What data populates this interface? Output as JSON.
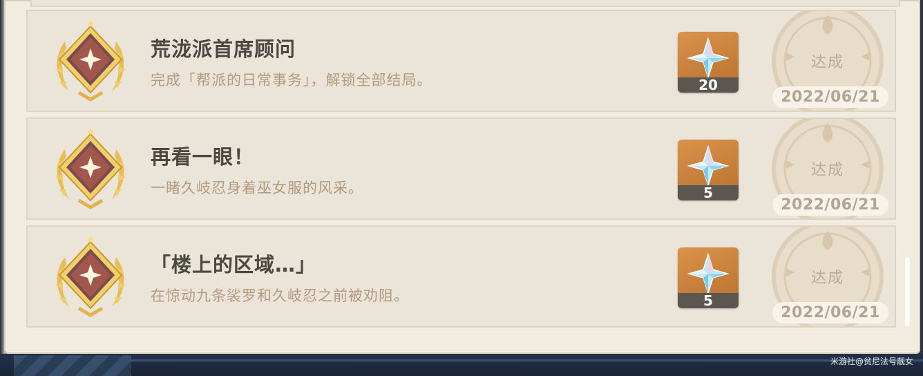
{
  "achievements": [
    {
      "title": "荒泷派首席顾问",
      "description": "完成「帮派的日常事务」，解锁全部结局。",
      "reward_count": "20",
      "status": "达成",
      "date": "2022/06/21"
    },
    {
      "title": "再看一眼！",
      "description": "一睹久岐忍身着巫女服的风采。",
      "reward_count": "5",
      "status": "达成",
      "date": "2022/06/21"
    },
    {
      "title": "「楼上的区域…」",
      "description": "在惊动九条裟罗和久岐忍之前被劝阻。",
      "reward_count": "5",
      "status": "达成",
      "date": "2022/06/21"
    }
  ],
  "icons": {
    "medal": "gold-laurel-medal-icon",
    "reward": "primogem-icon",
    "stamp": "completion-stamp-icon"
  },
  "colors": {
    "panel": "#f1ebe0",
    "card": "#ebe4d8",
    "title": "#4b4742",
    "description": "#b49a7f",
    "reward_bg": "#d9934a"
  },
  "watermark": "米游社@贫尼法号靓女"
}
